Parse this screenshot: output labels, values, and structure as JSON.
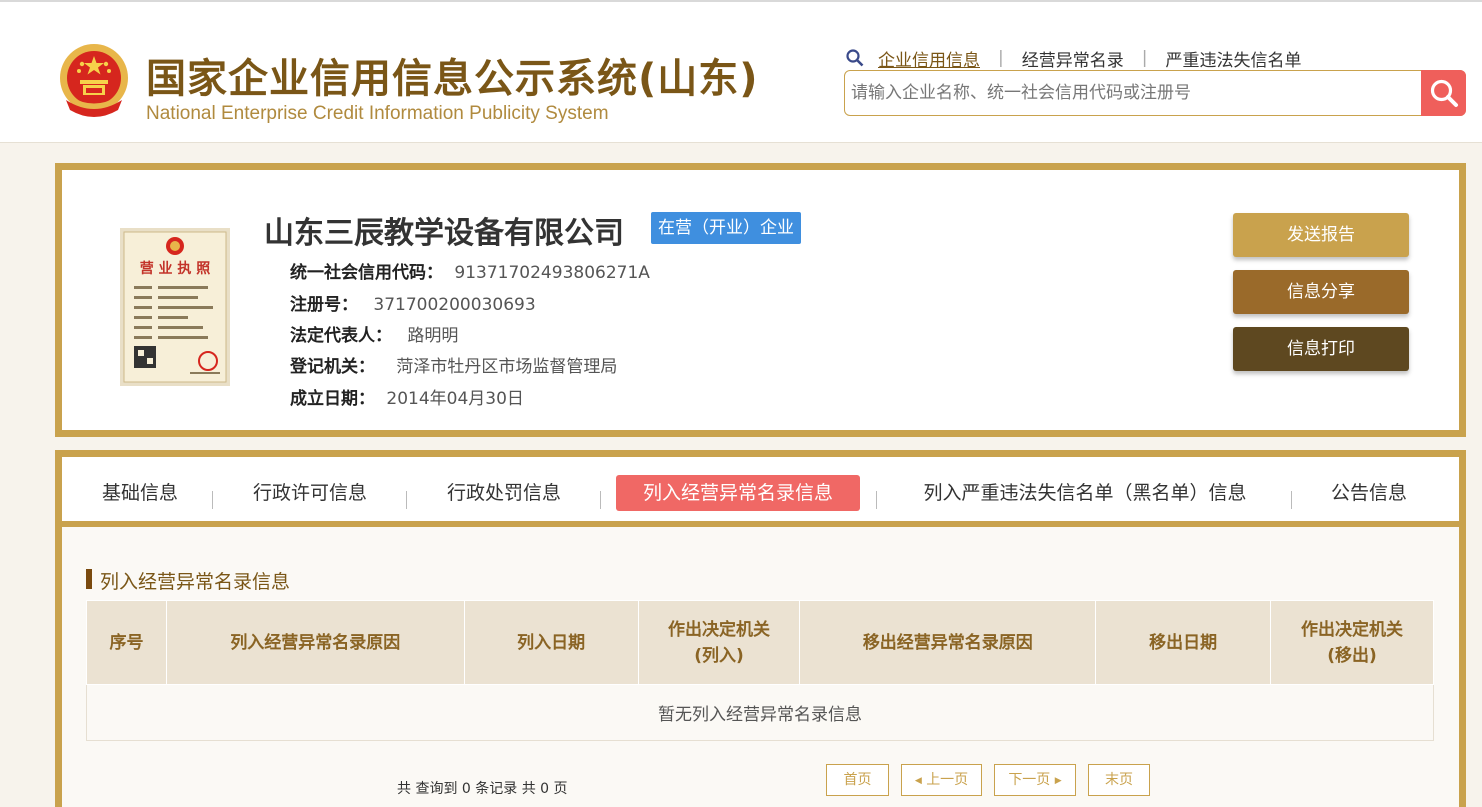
{
  "header": {
    "title": "国家企业信用信息公示系统(山东)",
    "subtitle": "National Enterprise Credit Information Publicity System",
    "nav": [
      "企业信用信息",
      "经营异常名录",
      "严重违法失信名单"
    ],
    "search_placeholder": "请输入企业名称、统一社会信用代码或注册号"
  },
  "company": {
    "name": "山东三辰教学设备有限公司",
    "status": "在营（开业）企业",
    "license_caption": "营 业 执 照",
    "fields": [
      {
        "label": "统一社会信用代码：",
        "value": "91371702493806271A"
      },
      {
        "label": "注册号：",
        "value": "371700200030693"
      },
      {
        "label": "法定代表人：",
        "value": "路明明"
      },
      {
        "label": "登记机关：",
        "value": "菏泽市牡丹区市场监督管理局"
      },
      {
        "label": "成立日期：",
        "value": "2014年04月30日"
      }
    ],
    "actions": [
      "发送报告",
      "信息分享",
      "信息打印"
    ]
  },
  "tabs": {
    "items": [
      "基础信息",
      "行政许可信息",
      "行政处罚信息",
      "列入经营异常名录信息",
      "列入严重违法失信名单（黑名单）信息",
      "公告信息"
    ],
    "active_index": 3
  },
  "section": {
    "title": "列入经营异常名录信息",
    "columns": [
      "序号",
      "列入经营异常名录原因",
      "列入日期",
      "作出决定机关\n(列入)",
      "移出经营异常名录原因",
      "移出日期",
      "作出决定机关\n(移出)"
    ],
    "empty_text": "暂无列入经营异常名录信息",
    "summary": "共 查询到 0 条记录 共 0 页"
  },
  "pagination": {
    "first": "首页",
    "prev": "上一页",
    "next": "下一页",
    "last": "末页"
  },
  "colors": {
    "gold": "#c9a24d",
    "brown_title": "#7a5617",
    "active_tab": "#f06865",
    "status_blue": "#3f8fdf",
    "btn_send": "#c9a24d",
    "btn_share": "#9a6a2a",
    "btn_print": "#5e4820",
    "search_red": "#ef5f5b"
  },
  "icons": {
    "nav": "search-icon",
    "search_button": "magnifier-icon",
    "emblem": "national-emblem-icon"
  }
}
